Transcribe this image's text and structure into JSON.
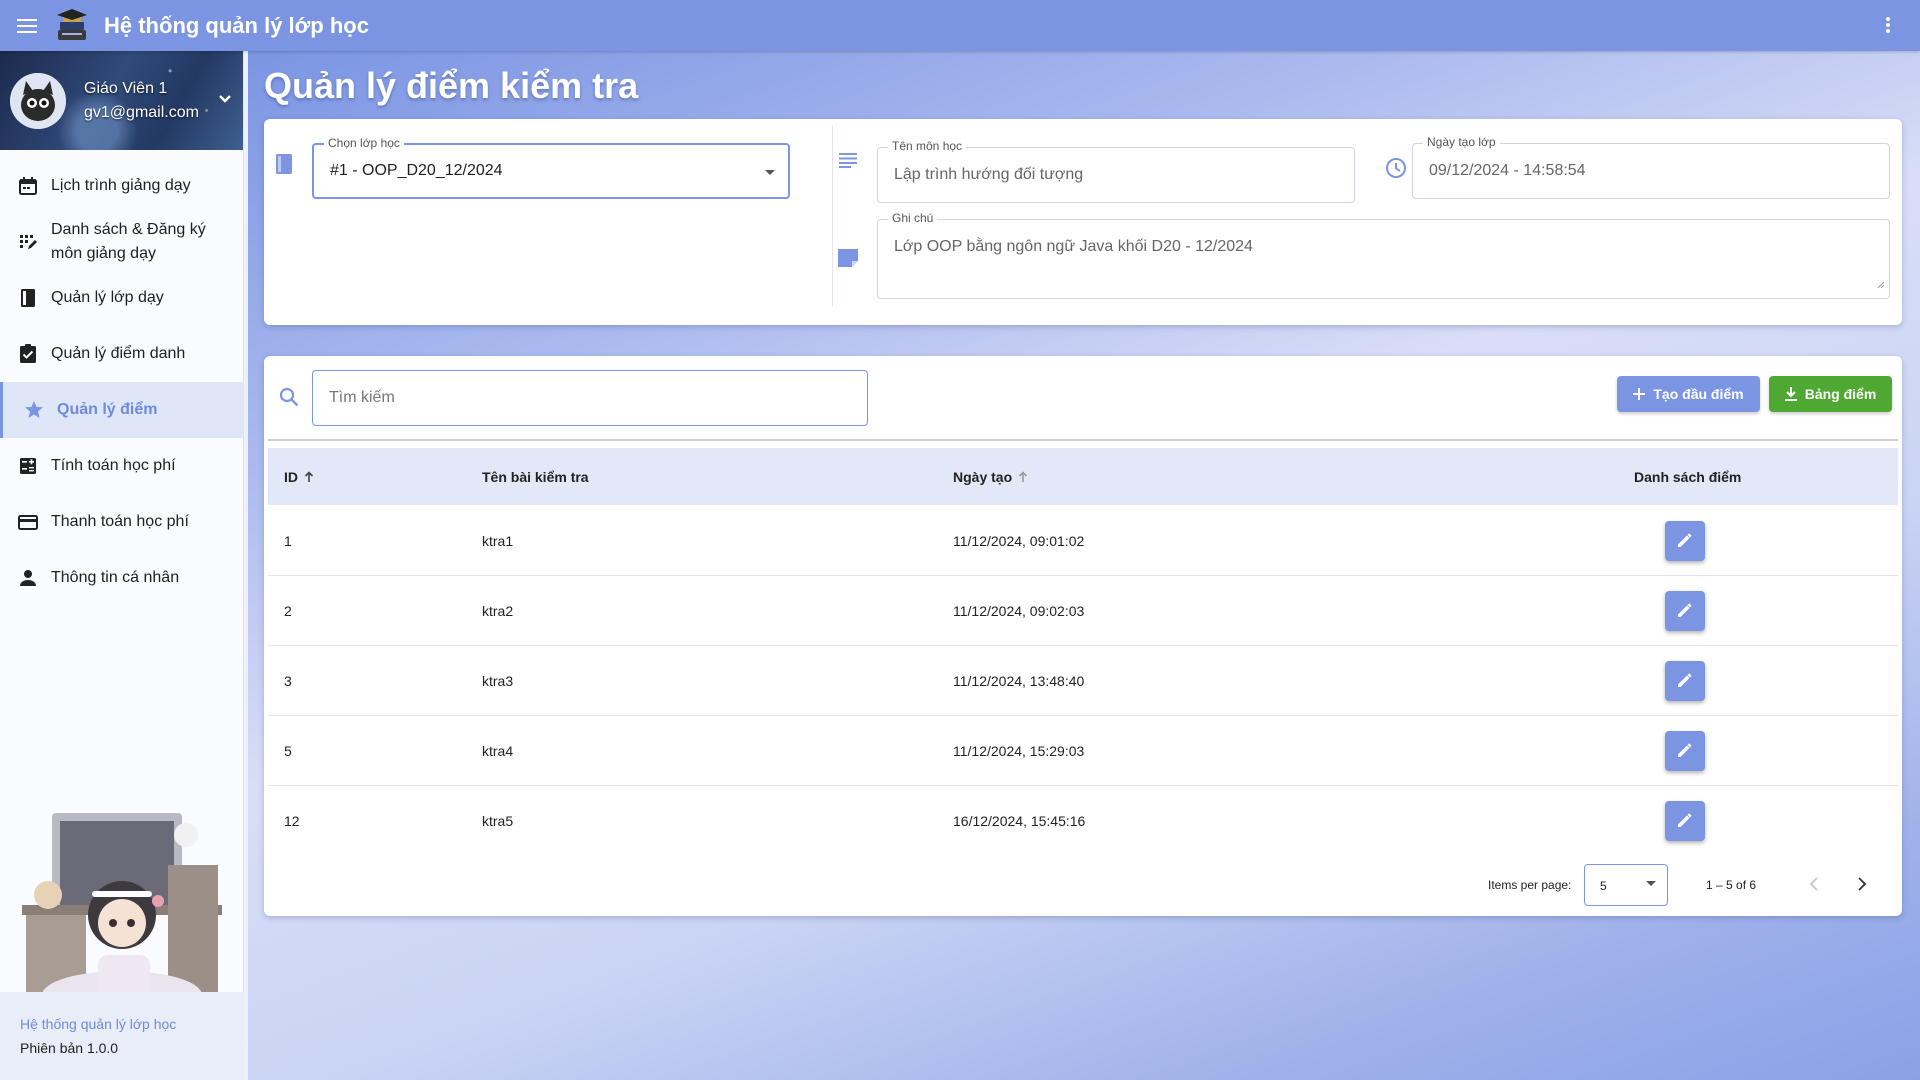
{
  "app": {
    "title": "Hệ thống quản lý lớp học"
  },
  "profile": {
    "name": "Giáo Viên 1",
    "email": "gv1@gmail.com"
  },
  "nav": [
    {
      "label": "Lịch trình giảng dạy",
      "icon": "calendar-icon"
    },
    {
      "label": "Danh sách & Đăng ký môn giảng dạy",
      "icon": "list-register-icon"
    },
    {
      "label": "Quản lý lớp dạy",
      "icon": "book-icon"
    },
    {
      "label": "Quản lý điểm danh",
      "icon": "checklist-icon"
    },
    {
      "label": "Quản lý điểm",
      "icon": "star-icon",
      "active": true
    },
    {
      "label": "Tính toán học phí",
      "icon": "calculator-icon"
    },
    {
      "label": "Thanh toán học phí",
      "icon": "credit-card-icon"
    },
    {
      "label": "Thông tin cá nhân",
      "icon": "person-icon"
    }
  ],
  "footer": {
    "app_name": "Hệ thống quản lý lớp học",
    "version_label": "Phiên bản",
    "version": "1.0.0"
  },
  "page": {
    "title": "Quản lý điểm kiểm tra"
  },
  "class_info": {
    "class_select_label": "Chọn lớp học",
    "class_select_value": "#1 - OOP_D20_12/2024",
    "subject_label": "Tên môn học",
    "subject_value": "Lập trình hướng đối tượng",
    "created_label": "Ngày tạo lớp",
    "created_value": "09/12/2024 - 14:58:54",
    "note_label": "Ghi chú",
    "note_value": "Lớp OOP bằng ngôn ngữ Java khối D20 - 12/2024"
  },
  "toolbar": {
    "search_placeholder": "Tìm kiếm",
    "create_label": "Tạo đầu điểm",
    "export_label": "Bảng điểm"
  },
  "table": {
    "headers": {
      "id": "ID",
      "name": "Tên bài kiểm tra",
      "created": "Ngày tạo",
      "scores": "Danh sách điểm"
    },
    "rows": [
      {
        "id": "1",
        "name": "ktra1",
        "created": "11/12/2024, 09:01:02"
      },
      {
        "id": "2",
        "name": "ktra2",
        "created": "11/12/2024, 09:02:03"
      },
      {
        "id": "3",
        "name": "ktra3",
        "created": "11/12/2024, 13:48:40"
      },
      {
        "id": "5",
        "name": "ktra4",
        "created": "11/12/2024, 15:29:03"
      },
      {
        "id": "12",
        "name": "ktra5",
        "created": "16/12/2024, 15:45:16"
      }
    ]
  },
  "paginator": {
    "items_per_page_label": "Items per page:",
    "items_per_page": "5",
    "range": "1 – 5 of 6"
  },
  "colors": {
    "primary": "#7b95e3",
    "success": "#4ea832",
    "header_row": "#e2e8f8"
  }
}
